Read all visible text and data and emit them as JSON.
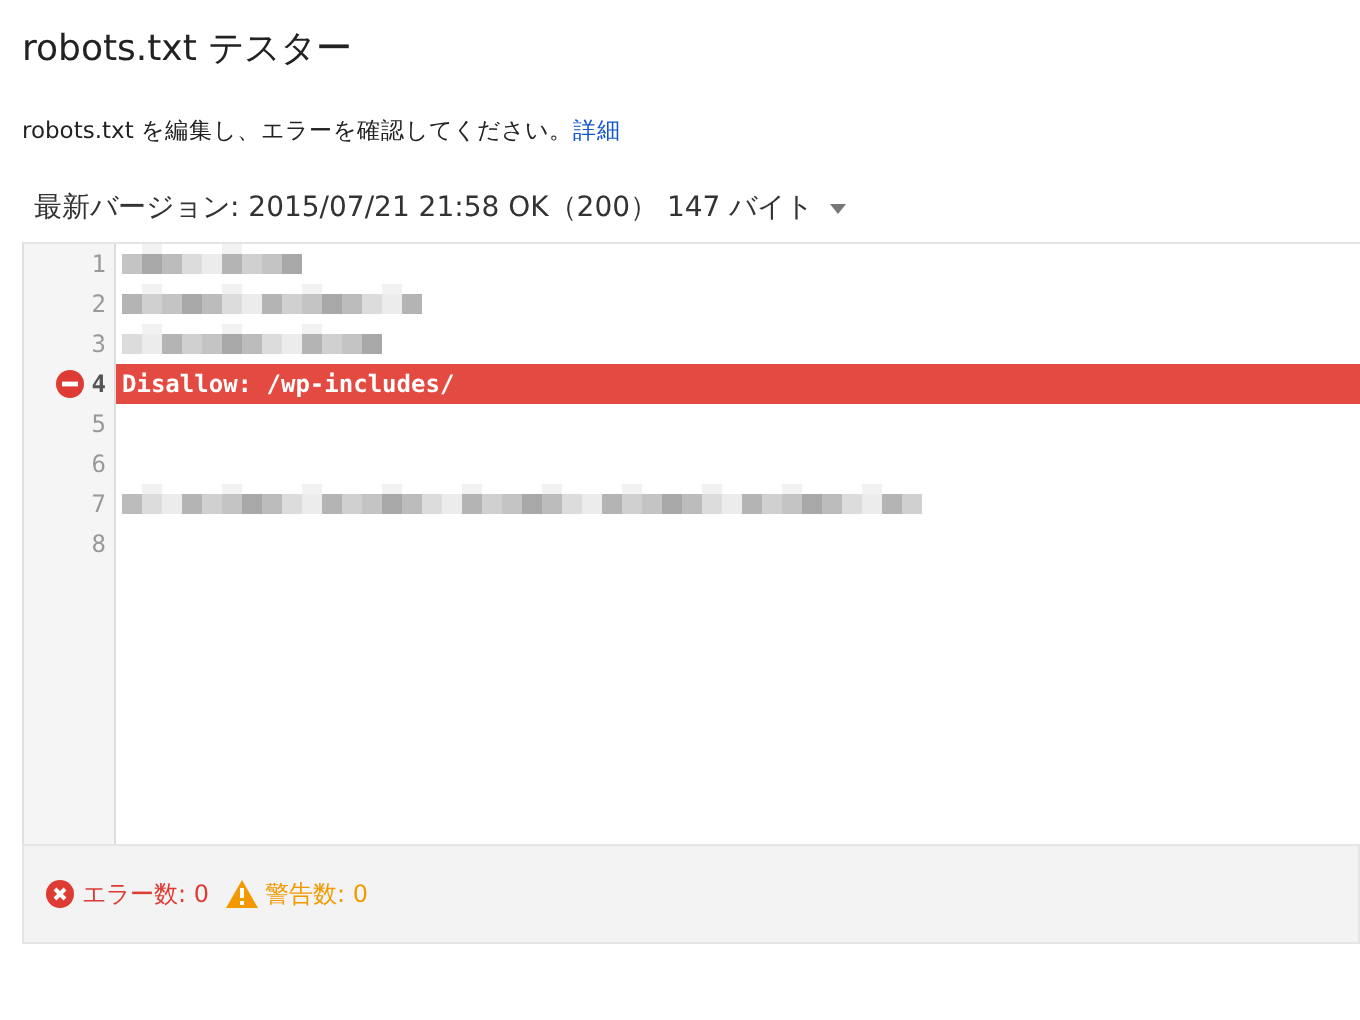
{
  "title": "robots.txt テスター",
  "description": {
    "text": "robots.txt を編集し、エラーを確認してください。",
    "link": "詳細"
  },
  "version": {
    "label": "最新バージョン: 2015/07/21 21:58 OK（200） 147 バイト"
  },
  "lines": [
    {
      "number": "1",
      "kind": "redacted",
      "error": false
    },
    {
      "number": "2",
      "kind": "redacted",
      "error": false
    },
    {
      "number": "3",
      "kind": "redacted",
      "error": false
    },
    {
      "number": "4",
      "kind": "code",
      "text": "Disallow: /wp-includes/",
      "error": true
    },
    {
      "number": "5",
      "kind": "blank",
      "error": false
    },
    {
      "number": "6",
      "kind": "blank",
      "error": false
    },
    {
      "number": "7",
      "kind": "redacted",
      "error": false
    },
    {
      "number": "8",
      "kind": "blank",
      "error": false
    }
  ],
  "status": {
    "errors": {
      "label": "エラー数:",
      "count": "0"
    },
    "warnings": {
      "label": "警告数:",
      "count": "0"
    }
  }
}
